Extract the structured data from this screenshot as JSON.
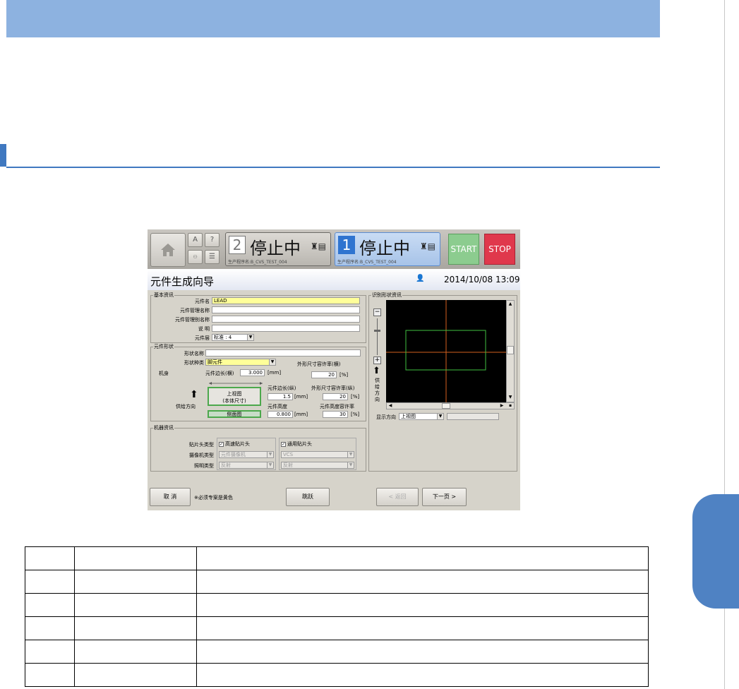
{
  "header": {
    "station2": {
      "num": "2",
      "label": "停止中",
      "program": "生产程序名:B_CVS_TEST_004"
    },
    "station1": {
      "num": "1",
      "label": "停止中",
      "program": "生产程序名:B_CVS_TEST_004"
    },
    "start_label": "START",
    "stop_label": "STOP",
    "mini_a": "A",
    "mini_q": "?"
  },
  "window": {
    "title": "元件生成向导",
    "datetime": "2014/10/08 13:09"
  },
  "basic": {
    "group_title": "基本资讯",
    "name_label": "元件名",
    "name_value": "LEAD",
    "mgmt_label": "元件管理名称",
    "mgmt_value": "",
    "mgmt_alias_label": "元件管理别名称",
    "mgmt_alias_value": "",
    "desc_label": "说 明",
    "desc_value": "",
    "layer_label": "元件层",
    "layer_value": "标准 : 4"
  },
  "shape": {
    "group_title": "元件形状",
    "shape_name_label": "形状名称",
    "shape_name_value": "",
    "shape_type_label": "形状种类",
    "shape_type_value": "脚元件",
    "body_label": "机身",
    "side_x_label": "元件边长(横)",
    "side_x_value": "3.000",
    "side_x_unit": "[mm]",
    "tol_x_label": "外形尺寸容许率(横)",
    "tol_x_value": "20",
    "tol_x_unit": "[%]",
    "side_y_label": "元件边长(纵)",
    "side_y_value": "1.5",
    "side_y_unit": "[mm]",
    "tol_y_label": "外形尺寸容许率(纵)",
    "tol_y_value": "20",
    "tol_y_unit": "[%]",
    "height_label": "元件高度",
    "height_value": "0.800",
    "height_unit": "[mm]",
    "tol_h_label": "元件高度容许率",
    "tol_h_value": "30",
    "tol_h_unit": "[%]",
    "feed_label": "供给方向",
    "top_view_line1": "上视图",
    "top_view_line2": "(本体尺寸)",
    "side_view": "侧面图"
  },
  "machine": {
    "group_title": "机器资讯",
    "head_label": "贴片头类型",
    "head1": "高速贴片头",
    "head2": "通用贴片头",
    "camera_label": "摄像机类型",
    "camera1": "元件摄像机",
    "camera2": "VCS",
    "light_label": "照明类型",
    "light1": "反射",
    "light2": "反射"
  },
  "recog": {
    "group_title": "识别形状资讯",
    "feed_vertical": "供给方向",
    "display_label": "显示方向",
    "display_value": "上视图"
  },
  "footer": {
    "cancel": "取 消",
    "note": "※必须专案是黄色",
    "skip": "跳跃",
    "back": "< 返回",
    "next": "下一页 >"
  }
}
